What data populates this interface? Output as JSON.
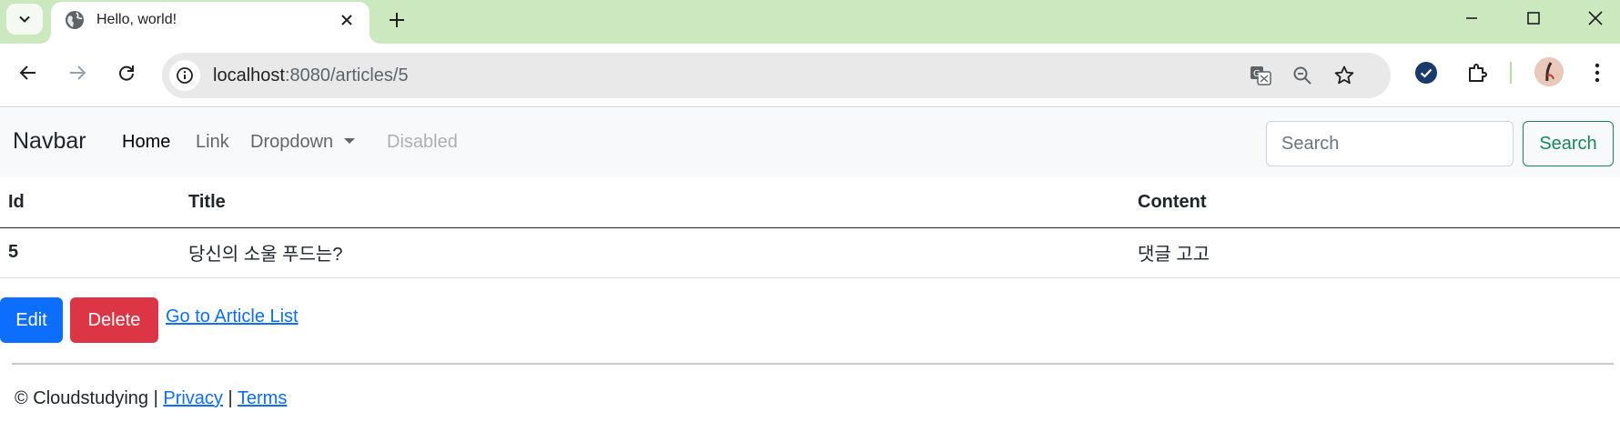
{
  "browser": {
    "tab": {
      "title": "Hello, world!"
    },
    "address": {
      "host": "localhost",
      "rest": ":8080/articles/5"
    },
    "icons": [
      "tab-search-icon",
      "globe-icon",
      "close-icon",
      "plus-icon",
      "minimize-icon",
      "maximize-icon",
      "close-window-icon",
      "back-icon",
      "forward-icon",
      "reload-icon",
      "site-info-icon",
      "translate-icon",
      "zoom-icon",
      "bookmark-star-icon",
      "check-extension-icon",
      "puzzle-extensions-icon",
      "profile-avatar",
      "kebab-menu-icon"
    ]
  },
  "navbar": {
    "brand": "Navbar",
    "links": {
      "home": "Home",
      "link": "Link",
      "dropdown": "Dropdown",
      "disabled": "Disabled"
    },
    "search_placeholder": "Search",
    "search_button": "Search"
  },
  "table": {
    "headers": {
      "id": "Id",
      "title": "Title",
      "content": "Content"
    },
    "rows": [
      {
        "id": "5",
        "title": "당신의 소울 푸드는?",
        "content": "댓글 고고"
      }
    ]
  },
  "actions": {
    "edit": "Edit",
    "delete": "Delete",
    "list_link": "Go to Article List"
  },
  "footer": {
    "copyright": "© Cloudstudying | ",
    "privacy": "Privacy",
    "separator": " | ",
    "terms": "Terms"
  },
  "colors": {
    "tabstrip": "#cbe8bf",
    "primary": "#0d6efd",
    "danger": "#dc3545",
    "success": "#198754"
  }
}
